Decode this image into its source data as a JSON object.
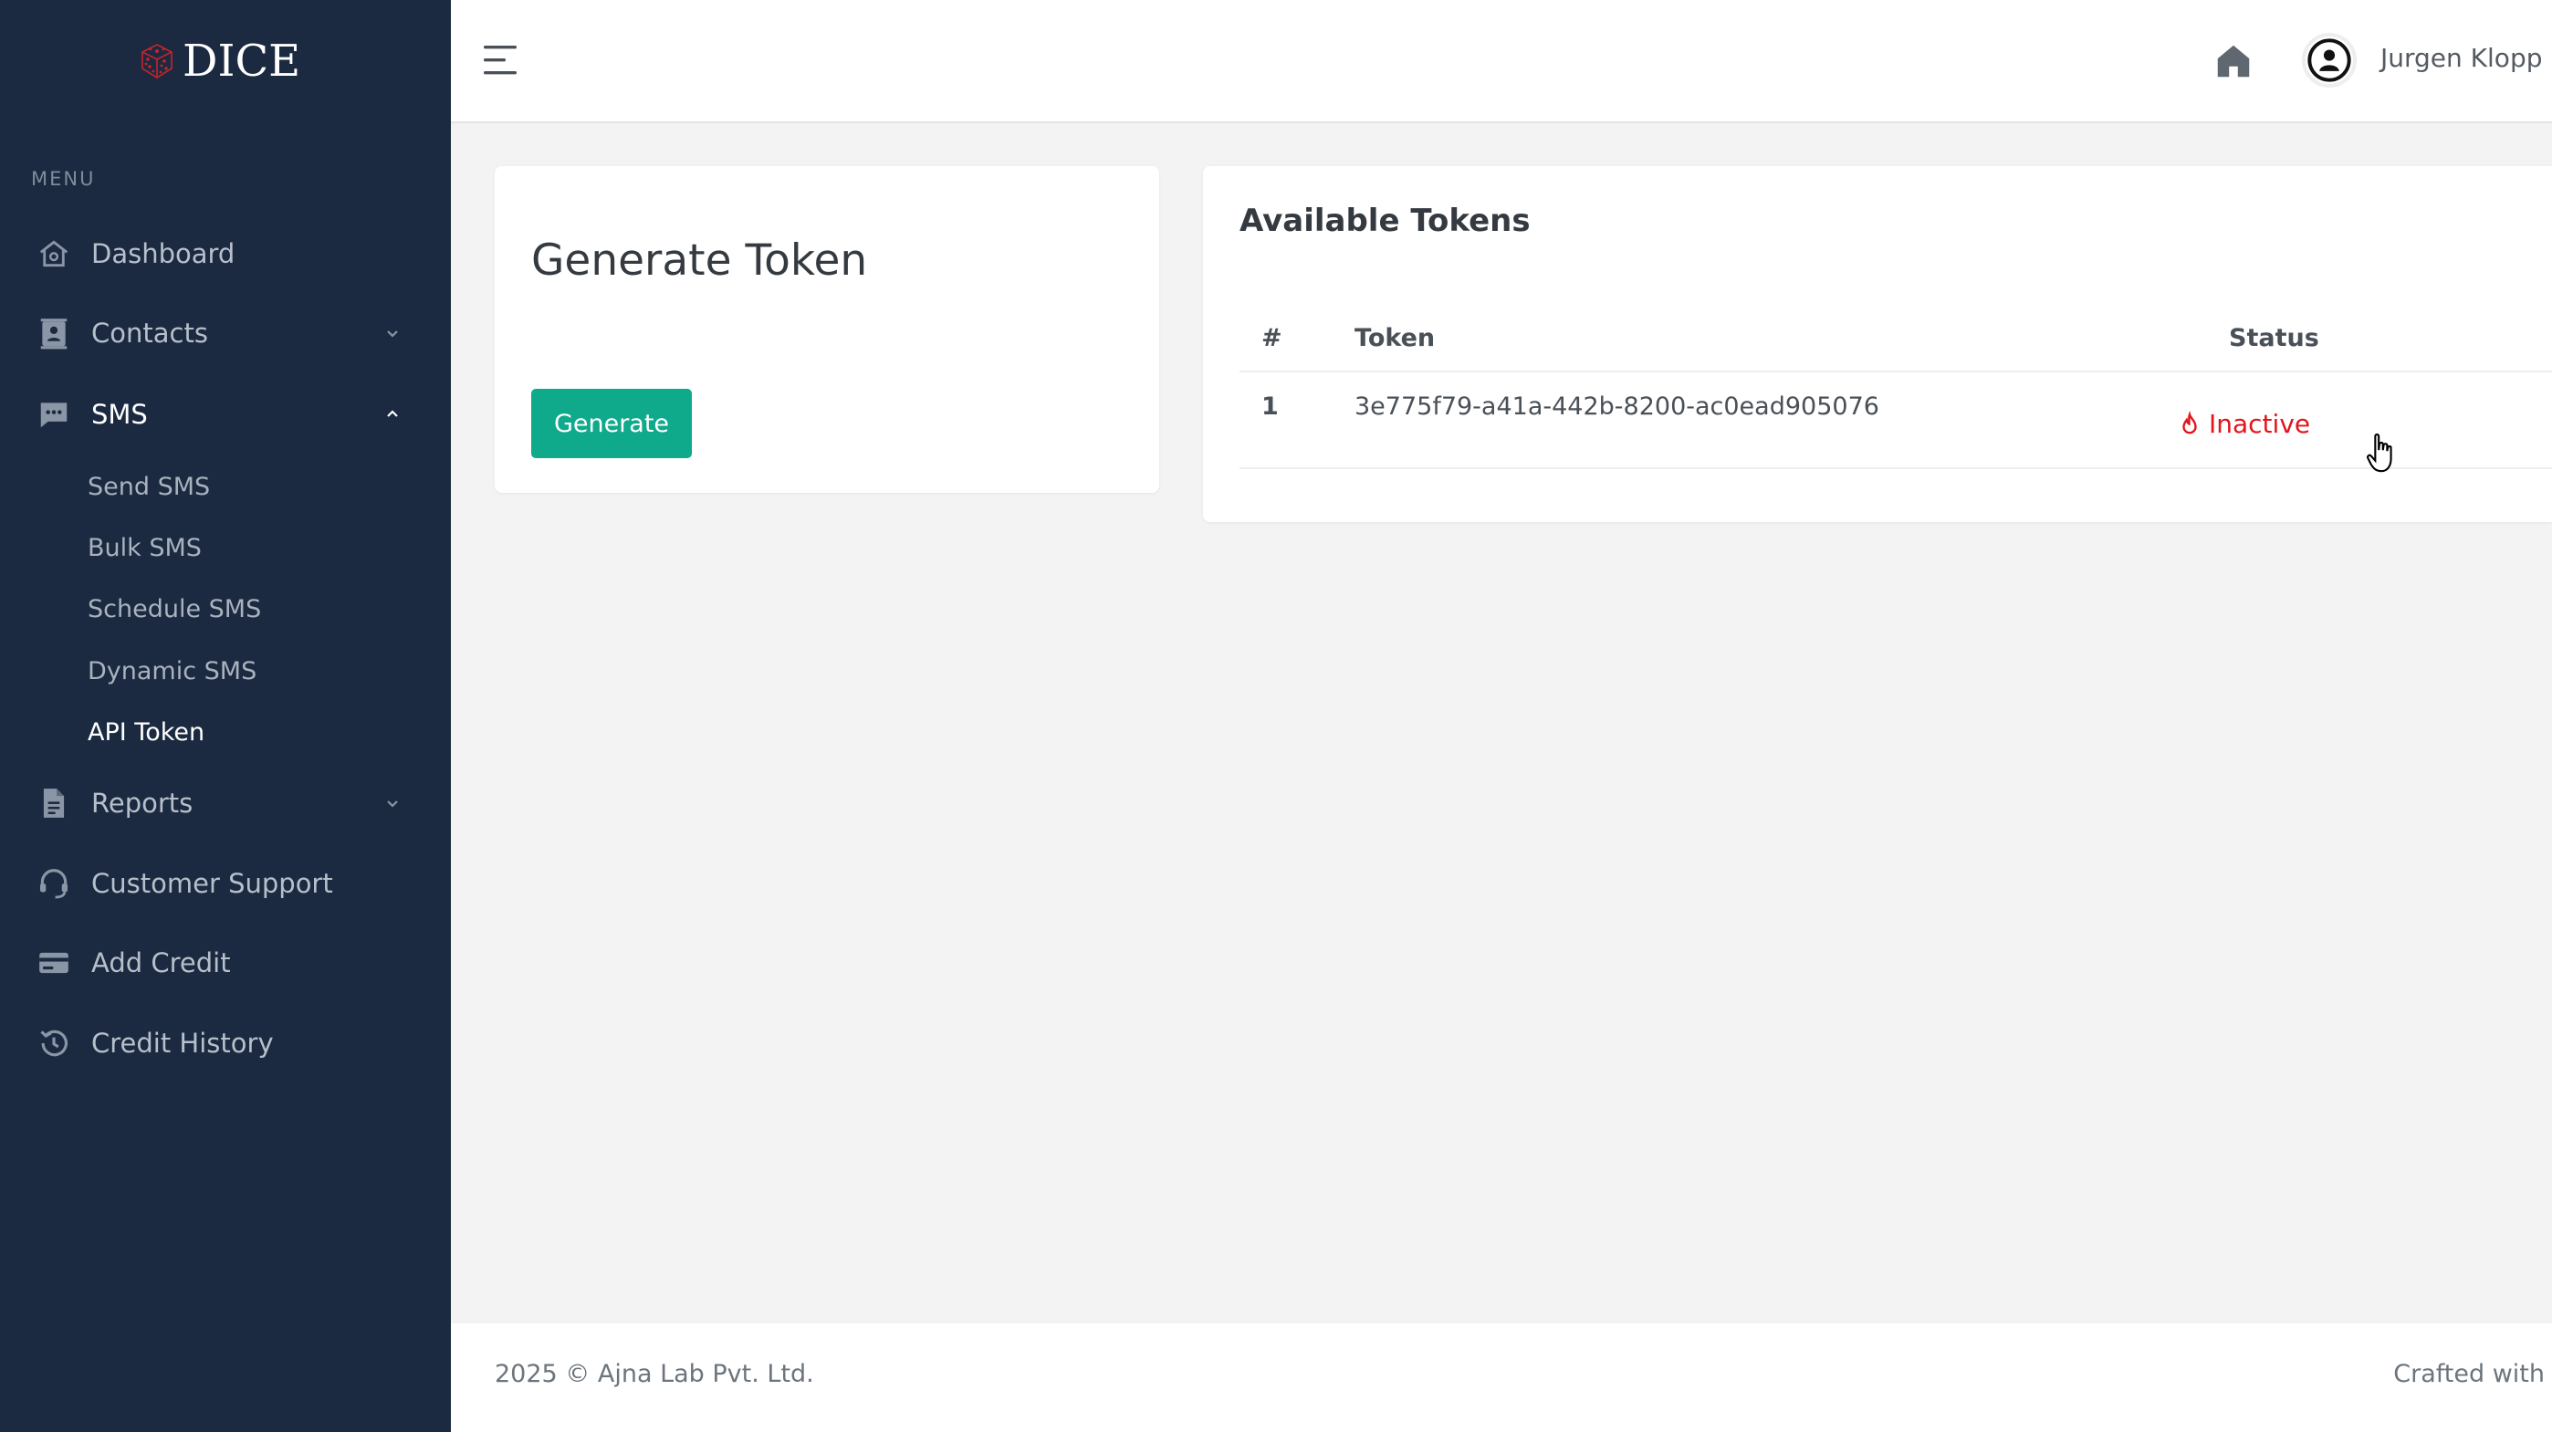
{
  "brand": {
    "name": "DICE",
    "logo_icon": "dice-cube-icon",
    "logo_color": "#c8232c"
  },
  "sidebar": {
    "menu_title": "MENU",
    "items": [
      {
        "label": "Dashboard",
        "icon": "home-outline-icon"
      },
      {
        "label": "Contacts",
        "icon": "contacts-book-icon",
        "chevron": "chevron-down-icon"
      },
      {
        "label": "SMS",
        "icon": "chat-bubble-icon",
        "chevron": "chevron-up-icon",
        "expanded": true
      },
      {
        "label": "Reports",
        "icon": "document-icon",
        "chevron": "chevron-down-icon"
      },
      {
        "label": "Customer Support",
        "icon": "headset-icon"
      },
      {
        "label": "Add Credit",
        "icon": "credit-card-icon"
      },
      {
        "label": "Credit History",
        "icon": "history-icon"
      }
    ],
    "sms_sub_items": [
      {
        "label": "Send SMS"
      },
      {
        "label": "Bulk SMS"
      },
      {
        "label": "Schedule SMS"
      },
      {
        "label": "Dynamic SMS"
      },
      {
        "label": "API Token",
        "active": true
      }
    ]
  },
  "topbar": {
    "menu_icon": "hamburger-icon",
    "home_icon": "home-icon",
    "avatar_icon": "user-circle-icon",
    "user_name": "Jurgen Klopp"
  },
  "generate_card": {
    "title": "Generate Token",
    "button_label": "Generate"
  },
  "tokens_card": {
    "title": "Available Tokens",
    "columns": [
      "#",
      "Token",
      "Status"
    ],
    "rows": [
      {
        "index": "1",
        "token": "3e775f79-a41a-442b-8200-ac0ead905076",
        "status": "Inactive",
        "status_icon": "flame-icon"
      }
    ]
  },
  "colors": {
    "sidebar_bg": "#1b2a40",
    "accent_button": "#0fa98b",
    "status_inactive": "#e3131b"
  },
  "footer": {
    "copyright": "2025 © Ajna Lab Pvt. Ltd.",
    "credit": "Crafted with"
  }
}
